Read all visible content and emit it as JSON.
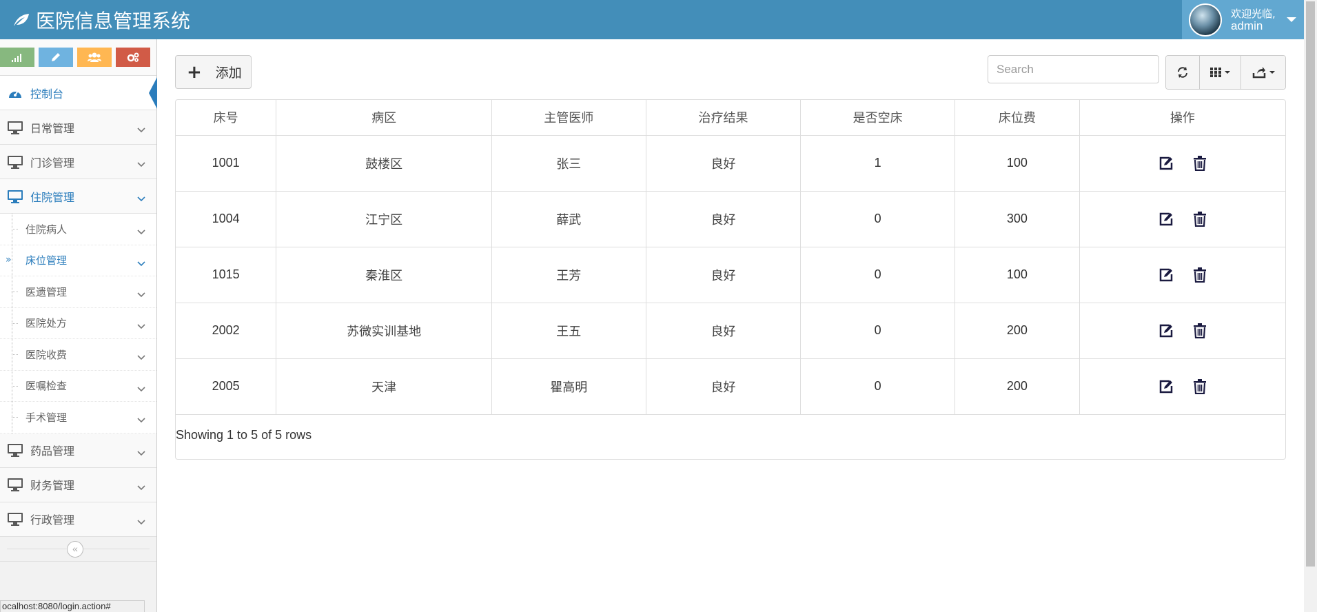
{
  "app": {
    "title": "医院信息管理系统"
  },
  "user": {
    "welcome": "欢迎光临,",
    "name": "admin"
  },
  "sidebar": {
    "dashboard": "控制台",
    "groups": [
      {
        "label": "日常管理"
      },
      {
        "label": "门诊管理"
      },
      {
        "label": "住院管理"
      }
    ],
    "submenu": [
      {
        "label": "住院病人"
      },
      {
        "label": "床位管理"
      },
      {
        "label": "医遗管理"
      },
      {
        "label": "医院处方"
      },
      {
        "label": "医院收费"
      },
      {
        "label": "医嘱检查"
      },
      {
        "label": "手术管理"
      }
    ],
    "bottom_groups": [
      {
        "label": "药品管理"
      },
      {
        "label": "财务管理"
      },
      {
        "label": "行政管理"
      }
    ],
    "shortcut_colors": [
      "#87b87f",
      "#6fb3e0",
      "#ffb752",
      "#d15b47"
    ]
  },
  "toolbar": {
    "add_label": "添加",
    "search_placeholder": "Search"
  },
  "table": {
    "headers": [
      "床号",
      "病区",
      "主管医师",
      "治疗结果",
      "是否空床",
      "床位费",
      "操作"
    ],
    "rows": [
      [
        "1001",
        "鼓楼区",
        "张三",
        "良好",
        "1",
        "100"
      ],
      [
        "1004",
        "江宁区",
        "薛武",
        "良好",
        "0",
        "300"
      ],
      [
        "1015",
        "秦淮区",
        "王芳",
        "良好",
        "0",
        "100"
      ],
      [
        "2002",
        "苏微实训基地",
        "王五",
        "良好",
        "0",
        "200"
      ],
      [
        "2005",
        "天津",
        "瞿高明",
        "良好",
        "0",
        "200"
      ]
    ],
    "footer": "Showing 1 to 5 of 5 rows"
  },
  "status_bar": {
    "url": "ocalhost:8080/login.action#"
  },
  "colors": {
    "navbar": "#438eb9",
    "accent": "#2b7dbc",
    "user_area": "#62a8d1"
  }
}
